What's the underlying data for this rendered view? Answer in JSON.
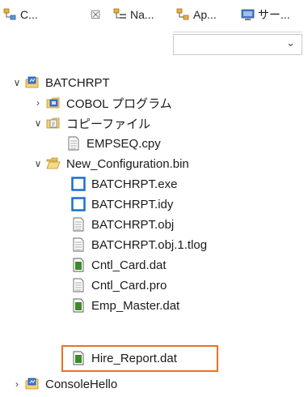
{
  "tabs": [
    {
      "label": "C...",
      "icon": "project-explorer-icon"
    },
    {
      "label": "Na...",
      "icon": "navigator-icon"
    },
    {
      "label": "Ap...",
      "icon": "application-icon"
    },
    {
      "label": "サー...",
      "icon": "server-icon"
    }
  ],
  "tab_close_glyph": "☒",
  "dropdown": {
    "value": "",
    "arrow": "⌄"
  },
  "tree": {
    "root": {
      "label": "BATCHRPT"
    },
    "cobol": {
      "label": "COBOL プログラム"
    },
    "copybook": {
      "label": "コピーファイル"
    },
    "empseq": {
      "label": "EMPSEQ.cpy"
    },
    "config": {
      "label": "New_Configuration.bin"
    },
    "items": [
      {
        "label": "BATCHRPT.exe",
        "icon": "exe"
      },
      {
        "label": "BATCHRPT.idy",
        "icon": "exe"
      },
      {
        "label": "BATCHRPT.obj",
        "icon": "file"
      },
      {
        "label": "BATCHRPT.obj.1.tlog",
        "icon": "file"
      },
      {
        "label": "Cntl_Card.dat",
        "icon": "dat"
      },
      {
        "label": "Cntl_Card.pro",
        "icon": "file"
      },
      {
        "label": "Emp_Master.dat",
        "icon": "dat"
      },
      {
        "label": "Hire_Report.dat",
        "icon": "dat"
      }
    ],
    "console": {
      "label": "ConsoleHello"
    }
  },
  "colors": {
    "highlight": "#f07020",
    "project_blue": "#1a6fd0",
    "dat_green": "#3c8a2a"
  }
}
